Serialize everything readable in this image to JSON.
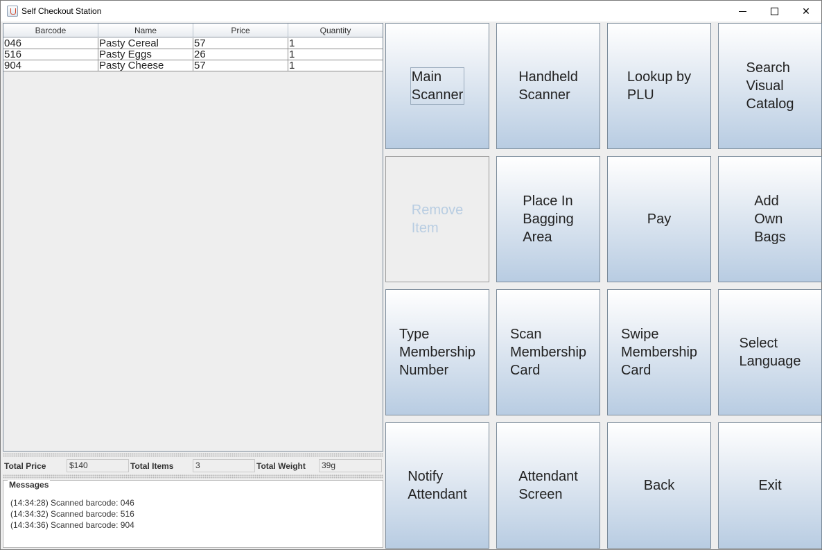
{
  "window": {
    "title": "Self Checkout Station"
  },
  "table": {
    "columns": [
      "Barcode",
      "Name",
      "Price",
      "Quantity"
    ],
    "rows": [
      [
        "046",
        "Pasty Cereal",
        "57",
        "1"
      ],
      [
        "516",
        "Pasty Eggs",
        "26",
        "1"
      ],
      [
        "904",
        "Pasty Cheese",
        "57",
        "1"
      ]
    ]
  },
  "totals": {
    "price_label": "Total Price",
    "price_value": "$140",
    "items_label": "Total Items",
    "items_value": "3",
    "weight_label": "Total Weight",
    "weight_value": "39g"
  },
  "messages": {
    "title": "Messages",
    "lines": [
      "(14:34:28) Scanned barcode: 046",
      "(14:34:32) Scanned barcode: 516",
      "(14:34:36) Scanned barcode: 904"
    ]
  },
  "buttons": [
    {
      "label": "Main\nScanner",
      "state": "focused"
    },
    {
      "label": "Handheld\nScanner",
      "state": "normal"
    },
    {
      "label": "Lookup by\nPLU",
      "state": "normal"
    },
    {
      "label": "Search\nVisual\nCatalog",
      "state": "normal"
    },
    {
      "label": "Remove\nItem",
      "state": "disabled"
    },
    {
      "label": "Place In\nBagging\nArea",
      "state": "normal"
    },
    {
      "label": "Pay",
      "state": "normal"
    },
    {
      "label": "Add\nOwn\nBags",
      "state": "normal"
    },
    {
      "label": "Type\nMembership\nNumber",
      "state": "normal"
    },
    {
      "label": "Scan\nMembership\nCard",
      "state": "normal"
    },
    {
      "label": "Swipe\nMembership\nCard",
      "state": "normal"
    },
    {
      "label": "Select\nLanguage",
      "state": "normal"
    },
    {
      "label": "Notify\nAttendant",
      "state": "normal"
    },
    {
      "label": "Attendant\nScreen",
      "state": "normal"
    },
    {
      "label": "Back",
      "state": "normal"
    },
    {
      "label": "Exit",
      "state": "normal"
    }
  ]
}
